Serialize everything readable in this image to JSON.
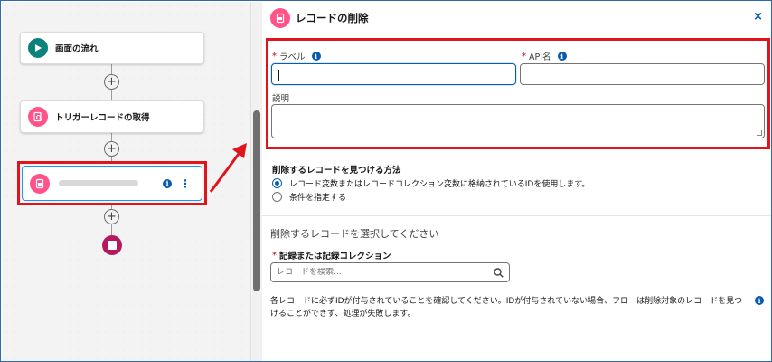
{
  "canvas": {
    "nodes": [
      {
        "label": "画面の流れ",
        "icon": "play-icon"
      },
      {
        "label": "トリガーレコードの取得",
        "icon": "record-lookup-icon"
      }
    ],
    "selected_node": {
      "icon": "record-delete-icon",
      "info": "i",
      "menu": "⋮"
    },
    "end_icon": "stop-icon",
    "add_symbol": "+"
  },
  "panel": {
    "title": "レコードの削除",
    "close": "×",
    "label_field": {
      "required": "*",
      "label": "ラベル",
      "info": "i",
      "value": ""
    },
    "api_field": {
      "required": "*",
      "label": "API名",
      "info": "i",
      "value": ""
    },
    "description_field": {
      "label": "説明",
      "value": ""
    },
    "find_method": {
      "title": "削除するレコードを見つける方法",
      "options": [
        {
          "label": "レコード変数またはレコードコレクション変数に格納されているIDを使用します。",
          "checked": true
        },
        {
          "label": "条件を指定する",
          "checked": false
        }
      ]
    },
    "select_heading": "削除するレコードを選択してください",
    "record_field": {
      "required": "*",
      "label": "記録または記録コレクション",
      "placeholder": "レコードを検索..."
    },
    "note": "各レコードに必ずIDが付与されていることを確認してください。IDが付与されていない場合、フローは削除対象のレコードを見つけることができず、処理が失敗します。",
    "note_info": "i"
  },
  "colors": {
    "accent": "#0b5cab",
    "delete_icon": "#ff538a",
    "screen_icon": "#0b827c",
    "end_node": "#b7175e",
    "highlight": "#e0151b"
  }
}
